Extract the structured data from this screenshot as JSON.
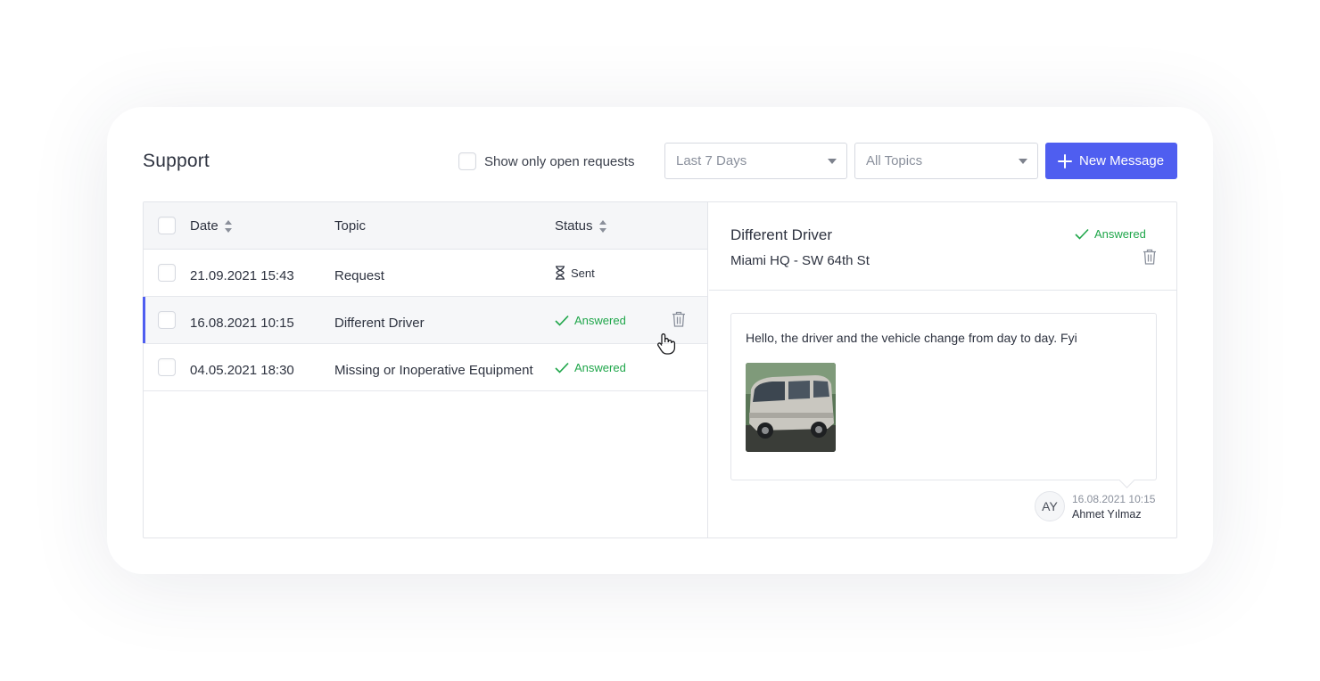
{
  "header": {
    "title": "Support",
    "open_only_label": "Show only open requests",
    "date_filter": "Last 7 Days",
    "topic_filter": "All Topics",
    "new_message_label": "New Message"
  },
  "table": {
    "columns": {
      "date": "Date",
      "topic": "Topic",
      "status": "Status"
    },
    "rows": [
      {
        "date": "21.09.2021 15:43",
        "topic": "Request",
        "status": "Sent"
      },
      {
        "date": "16.08.2021 10:15",
        "topic": "Different Driver",
        "status": "Answered"
      },
      {
        "date": "04.05.2021 18:30",
        "topic": "Missing or Inoperative Equipment",
        "status": "Answered"
      }
    ]
  },
  "detail": {
    "title": "Different Driver",
    "location": "Miami HQ - SW 64th  St",
    "status": "Answered",
    "message": {
      "text": "Hello, the driver and the vehicle change from day to day. Fyi",
      "timestamp": "16.08.2021 10:15",
      "author": "Ahmet Yılmaz",
      "initials": "AY"
    }
  },
  "colors": {
    "primary": "#4f5ef0",
    "answered": "#1fa64a"
  }
}
